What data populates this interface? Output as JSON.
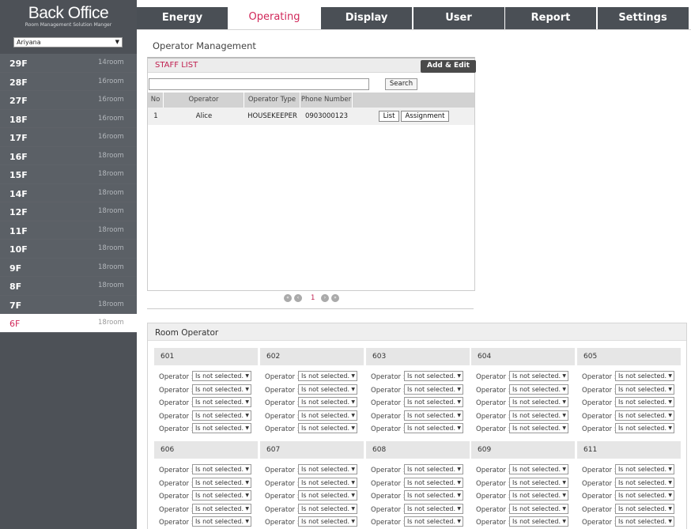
{
  "app": {
    "title": "Back Office",
    "subtitle": "Room Management Solution Manger"
  },
  "building_select": {
    "value": "Ariyana"
  },
  "floors": [
    {
      "name": "29F",
      "rooms": "14room"
    },
    {
      "name": "28F",
      "rooms": "16room"
    },
    {
      "name": "27F",
      "rooms": "16room"
    },
    {
      "name": "18F",
      "rooms": "16room"
    },
    {
      "name": "17F",
      "rooms": "16room"
    },
    {
      "name": "16F",
      "rooms": "18room"
    },
    {
      "name": "15F",
      "rooms": "18room"
    },
    {
      "name": "14F",
      "rooms": "18room"
    },
    {
      "name": "12F",
      "rooms": "18room"
    },
    {
      "name": "11F",
      "rooms": "18room"
    },
    {
      "name": "10F",
      "rooms": "18room"
    },
    {
      "name": "9F",
      "rooms": "18room"
    },
    {
      "name": "8F",
      "rooms": "18room"
    },
    {
      "name": "7F",
      "rooms": "18room"
    },
    {
      "name": "6F",
      "rooms": "18room",
      "active": true
    }
  ],
  "tabs": [
    {
      "label": "Energy"
    },
    {
      "label": "Operating",
      "active": true
    },
    {
      "label": "Display"
    },
    {
      "label": "User"
    },
    {
      "label": "Report"
    },
    {
      "label": "Settings"
    }
  ],
  "page_title": "Operator Management",
  "staff_list": {
    "title": "STAFF LIST",
    "add_edit_label": "Add & Edit",
    "search_value": "",
    "search_label": "Search",
    "columns": [
      "No",
      "Operator",
      "Operator Type",
      "Phone Number"
    ],
    "rows": [
      {
        "no": "1",
        "operator": "Alice",
        "type": "HOUSEKEEPER",
        "phone": "0903000123",
        "list_label": "List",
        "assign_label": "Assignment"
      }
    ]
  },
  "pagination": {
    "current": "1"
  },
  "room_operator": {
    "title": "Room Operator",
    "operator_label": "Operator :",
    "select_value": "Is not selected.",
    "rooms": [
      "601",
      "602",
      "603",
      "604",
      "605",
      "606",
      "607",
      "608",
      "609",
      "611"
    ]
  },
  "colors": {
    "accent": "#d1285a",
    "sidebar": "#4d5157",
    "tab": "#4a4f55"
  }
}
